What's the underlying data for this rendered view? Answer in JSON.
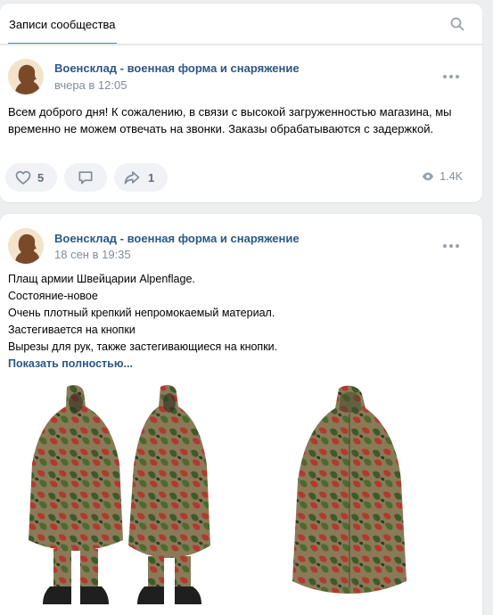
{
  "tabs": {
    "active_label": "Записи сообщества"
  },
  "posts": [
    {
      "author": "Военсклад - военная форма и снаряжение",
      "date": "вчера в 12:05",
      "text": "Всем доброго дня! К сожалению, в связи с высокой загруженностью магазина, мы временно не можем отвечать на звонки. Заказы обрабатываются с задержкой.",
      "likes": "5",
      "shares": "1",
      "views": "1.4K"
    },
    {
      "author": "Военсклад - военная форма и снаряжение",
      "date": "18 сен в 19:35",
      "lines": [
        "Плащ армии Швейцарии Alpenflage.",
        "Состояние-новое",
        "Очень плотный крепкий непромокаемый материал.",
        "Застегивается на кнопки",
        "Вырезы для рук, также застегивающиеся на кнопки."
      ],
      "show_more": "Показать полностью..."
    }
  ],
  "colors": {
    "link": "#2a5885",
    "accent": "#5181b8",
    "secondary": "#818c99",
    "background": "#edeef0"
  },
  "icons": [
    "search-icon",
    "more-icon",
    "heart-icon",
    "comment-icon",
    "share-icon",
    "eye-icon"
  ]
}
